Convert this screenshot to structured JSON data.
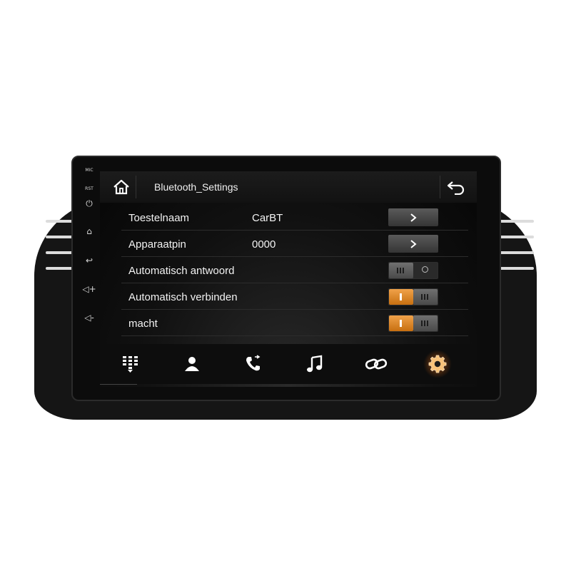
{
  "header": {
    "title": "Bluetooth_Settings"
  },
  "side_buttons": [
    {
      "label": "MIC",
      "icon": "mic-label"
    },
    {
      "label": "RST",
      "icon": "reset-label"
    },
    {
      "label": "⏻",
      "icon": "power-icon"
    },
    {
      "label": "⌂",
      "icon": "home-icon"
    },
    {
      "label": "↩",
      "icon": "back-icon"
    },
    {
      "label": "◁+",
      "icon": "volume-up-icon"
    },
    {
      "label": "◁-",
      "icon": "volume-down-icon"
    }
  ],
  "settings": {
    "device_name": {
      "label": "Toestelnaam",
      "value": "CarBT"
    },
    "device_pin": {
      "label": "Apparaatpin",
      "value": "0000"
    },
    "auto_answer": {
      "label": "Automatisch antwoord",
      "state": "off"
    },
    "auto_connect": {
      "label": "Automatisch verbinden",
      "state": "on"
    },
    "power": {
      "label": "macht",
      "state": "on"
    }
  },
  "bottom_nav": [
    {
      "name": "dialpad",
      "icon": "dialpad-icon"
    },
    {
      "name": "contacts",
      "icon": "contacts-icon"
    },
    {
      "name": "call-log",
      "icon": "phone-icon"
    },
    {
      "name": "music",
      "icon": "music-icon"
    },
    {
      "name": "connect",
      "icon": "link-icon"
    },
    {
      "name": "settings",
      "icon": "gear-icon",
      "active": true
    }
  ],
  "colors": {
    "accent": "#e8902c",
    "screen_bg": "#0a0a0a",
    "text": "#f2f2f2"
  }
}
